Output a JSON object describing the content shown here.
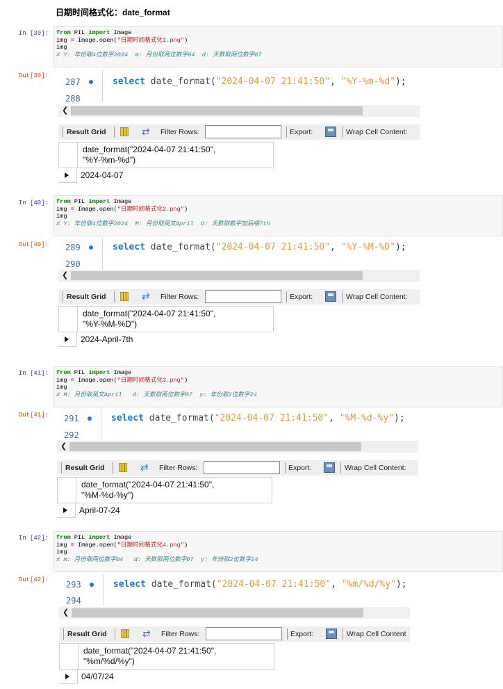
{
  "heading": "日期时间格式化：date_format",
  "toolbar": {
    "result_grid": "Result Grid",
    "filter_rows": "Filter Rows:",
    "export": "Export:",
    "wrap": "Wrap Cell Content:"
  },
  "cells": [
    {
      "in_prompt": "In  [39]:",
      "out_prompt": "Out[39]:",
      "code_file": "\"日期时间格式化1.png\"",
      "comment": "# Y: 年份取4位数字2024  m: 月份取两位数字04  d: 天数取两位数字07",
      "line1": "287",
      "line2": "288",
      "sql_fn": "date_format(",
      "sql_arg1": "\"2024-04-07 21:41:50\"",
      "sql_arg2": "\"%Y-%m-%d\"",
      "col_line1": "date_format(\"2024-04-07 21:41:50\",",
      "col_line2": "\"%Y-%m-%d\")",
      "value": "2024-04-07"
    },
    {
      "in_prompt": "In  [40]:",
      "out_prompt": "Out[40]:",
      "code_file": "\"日期时间格式化2.png\"",
      "comment": "# Y: 年份取4位数字2024  M: 月份取英文April  D: 天数取数字加后缀7th",
      "line1": "289",
      "line2": "290",
      "sql_fn": "date_format(",
      "sql_arg1": "\"2024-04-07 21:41:50\"",
      "sql_arg2": "\"%Y-%M-%D\"",
      "col_line1": "date_format(\"2024-04-07 21:41:50\",",
      "col_line2": "\"%Y-%M-%D\")",
      "value": "2024-April-7th"
    },
    {
      "in_prompt": "In  [41]:",
      "out_prompt": "Out[41]:",
      "code_file": "\"日期时间格式化3.png\"",
      "comment": "# M: 月份取英文April   d: 天数取两位数字07  y: 年份取2位数字24",
      "line1": "291",
      "line2": "292",
      "sql_fn": "date_format(",
      "sql_arg1": "\"2024-04-07 21:41:50\"",
      "sql_arg2": "\"%M-%d-%y\"",
      "col_line1": "date_format(\"2024-04-07 21:41:50\",",
      "col_line2": "\"%M-%d-%y\")",
      "value": "April-07-24"
    },
    {
      "in_prompt": "In  [42]:",
      "out_prompt": "Out[42]:",
      "code_file": "\"日期时间格式化4.png\"",
      "comment": "# m: 月份取两位数字04   d: 天数取两位数字07  y: 年份取2位数字24",
      "line1": "293",
      "line2": "294",
      "sql_fn": "date_format(",
      "sql_arg1": "\"2024-04-07 21:41:50\"",
      "sql_arg2": "\"%m/%d/%y\"",
      "col_line1": "date_format(\"2024-04-07 21:41:50\",",
      "col_line2": "\"%m/%d/%y\")",
      "value": "04/07/24"
    }
  ],
  "code_words": {
    "from": "from",
    "pil": " PIL ",
    "import": "import",
    "image": " Image",
    "img_assign": "img ",
    "eq": "=",
    "open_call": " Image.open(",
    "close_paren": ")",
    "img": "img",
    "select": "select",
    "semicolon": ");",
    "comma": ", ",
    "wrap_last": "Wrap Cell Content"
  },
  "colors": {
    "in_prompt": "#303f9f",
    "out_prompt": "#d84315",
    "sql_keyword": "#1e7bc8",
    "sql_string": "#e29a3b"
  }
}
